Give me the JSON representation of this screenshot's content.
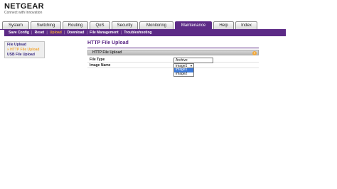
{
  "brand": {
    "name": "NETGEAR",
    "tagline": "Connect with Innovation"
  },
  "tabs": [
    {
      "label": "System"
    },
    {
      "label": "Switching"
    },
    {
      "label": "Routing"
    },
    {
      "label": "QoS"
    },
    {
      "label": "Security"
    },
    {
      "label": "Monitoring"
    },
    {
      "label": "Maintenance"
    },
    {
      "label": "Help"
    },
    {
      "label": "Index"
    }
  ],
  "subnav": [
    {
      "label": "Save Config"
    },
    {
      "label": "Reset"
    },
    {
      "label": "Upload"
    },
    {
      "label": "Download"
    },
    {
      "label": "File Management"
    },
    {
      "label": "Troubleshooting"
    }
  ],
  "sidebar": [
    {
      "label": "File Upload"
    },
    {
      "label": "» HTTP File Upload"
    },
    {
      "label": "USB File Upload"
    }
  ],
  "page": {
    "title": "HTTP File Upload"
  },
  "panel": {
    "title": "HTTP File Upload",
    "help": "?",
    "file_type_label": "File Type",
    "file_type_value": "Archive",
    "image_name_label": "Image Name",
    "image_name_value": "image1",
    "image_options": [
      "image1",
      "image2"
    ]
  },
  "colors": {
    "brand_purple": "#5c2a86",
    "active_orange": "#f2a93b",
    "selection_blue": "#3b78d8"
  }
}
